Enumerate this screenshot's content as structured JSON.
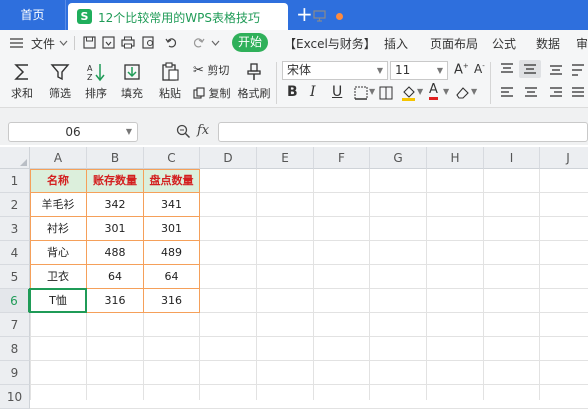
{
  "tabs": {
    "home": "首页",
    "document_title": "12个比较常用的WPS表格技巧",
    "doc_icon_letter": "S",
    "new_tab": "+"
  },
  "menu": {
    "file": "文件",
    "start": "开始",
    "items": [
      "【Excel与财务】",
      "插入",
      "页面布局",
      "公式",
      "数据",
      "审"
    ]
  },
  "toolbar": {
    "sum": "求和",
    "filter": "筛选",
    "sort": "排序",
    "fill": "填充",
    "paste": "粘贴",
    "cut": "剪切",
    "copy": "复制",
    "format_painter": "格式刷",
    "font_name": "宋体",
    "font_size": "11",
    "bold": "B",
    "italic": "I",
    "underline": "U"
  },
  "formula_bar": {
    "name_box": "06",
    "fx": "fx",
    "value": ""
  },
  "sheet": {
    "columns": [
      "A",
      "B",
      "C",
      "D",
      "E",
      "F",
      "G",
      "H",
      "I",
      "J"
    ],
    "rows": [
      "1",
      "2",
      "3",
      "4",
      "5",
      "6",
      "7",
      "8",
      "9",
      "10"
    ],
    "header": [
      "名称",
      "账存数量",
      "盘点数量"
    ],
    "data": [
      [
        "羊毛衫",
        "342",
        "341"
      ],
      [
        "衬衫",
        "301",
        "301"
      ],
      [
        "背心",
        "488",
        "489"
      ],
      [
        "卫衣",
        "64",
        "64"
      ],
      [
        "T恤",
        "316",
        "316"
      ]
    ]
  },
  "colors": {
    "accent_blue": "#2e6fdd",
    "accent_green": "#1f9b57",
    "header_fill": "#dcefdc",
    "header_text": "#d31f1f",
    "border_orange": "#f5a05a"
  }
}
